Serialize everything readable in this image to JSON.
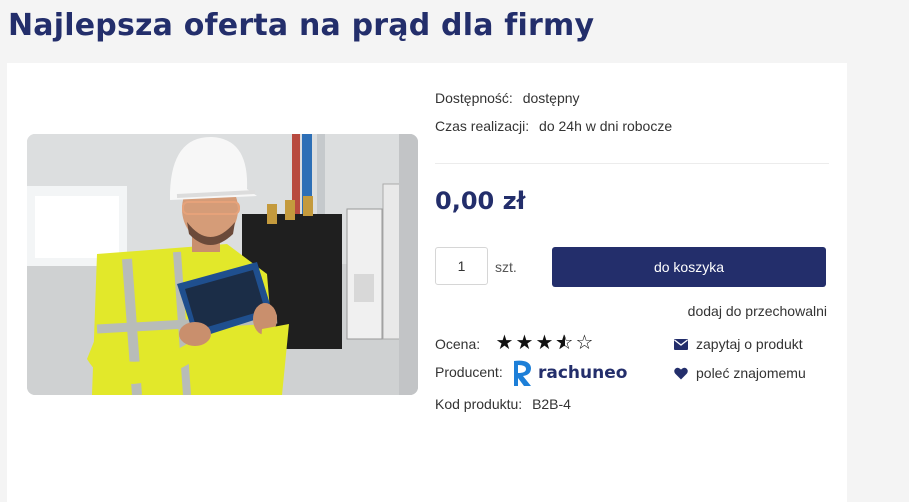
{
  "page": {
    "title": "Najlepsza oferta na prąd dla firmy"
  },
  "product": {
    "availability_label": "Dostępność:",
    "availability_value": "dostępny",
    "lead_time_label": "Czas realizacji:",
    "lead_time_value": "do 24h w dni robocze",
    "price": "0,00 zł",
    "quantity": "1",
    "unit": "szt.",
    "add_to_cart_label": "do koszyka",
    "storage_link": "dodaj do przechowalni",
    "rating_label": "Ocena:",
    "rating_value": 3.5,
    "rating_max": 5,
    "producer_label": "Producent:",
    "producer_logo": "rachuneo",
    "code_label": "Kod produktu:",
    "code_value": "B2B-4"
  },
  "actions": {
    "ask_label": "zapytaj o produkt",
    "ask_icon": "envelope-icon",
    "recommend_label": "poleć znajomemu",
    "recommend_icon": "heart-icon"
  },
  "colors": {
    "brand": "#232e6b",
    "background": "#f4f4f4"
  }
}
